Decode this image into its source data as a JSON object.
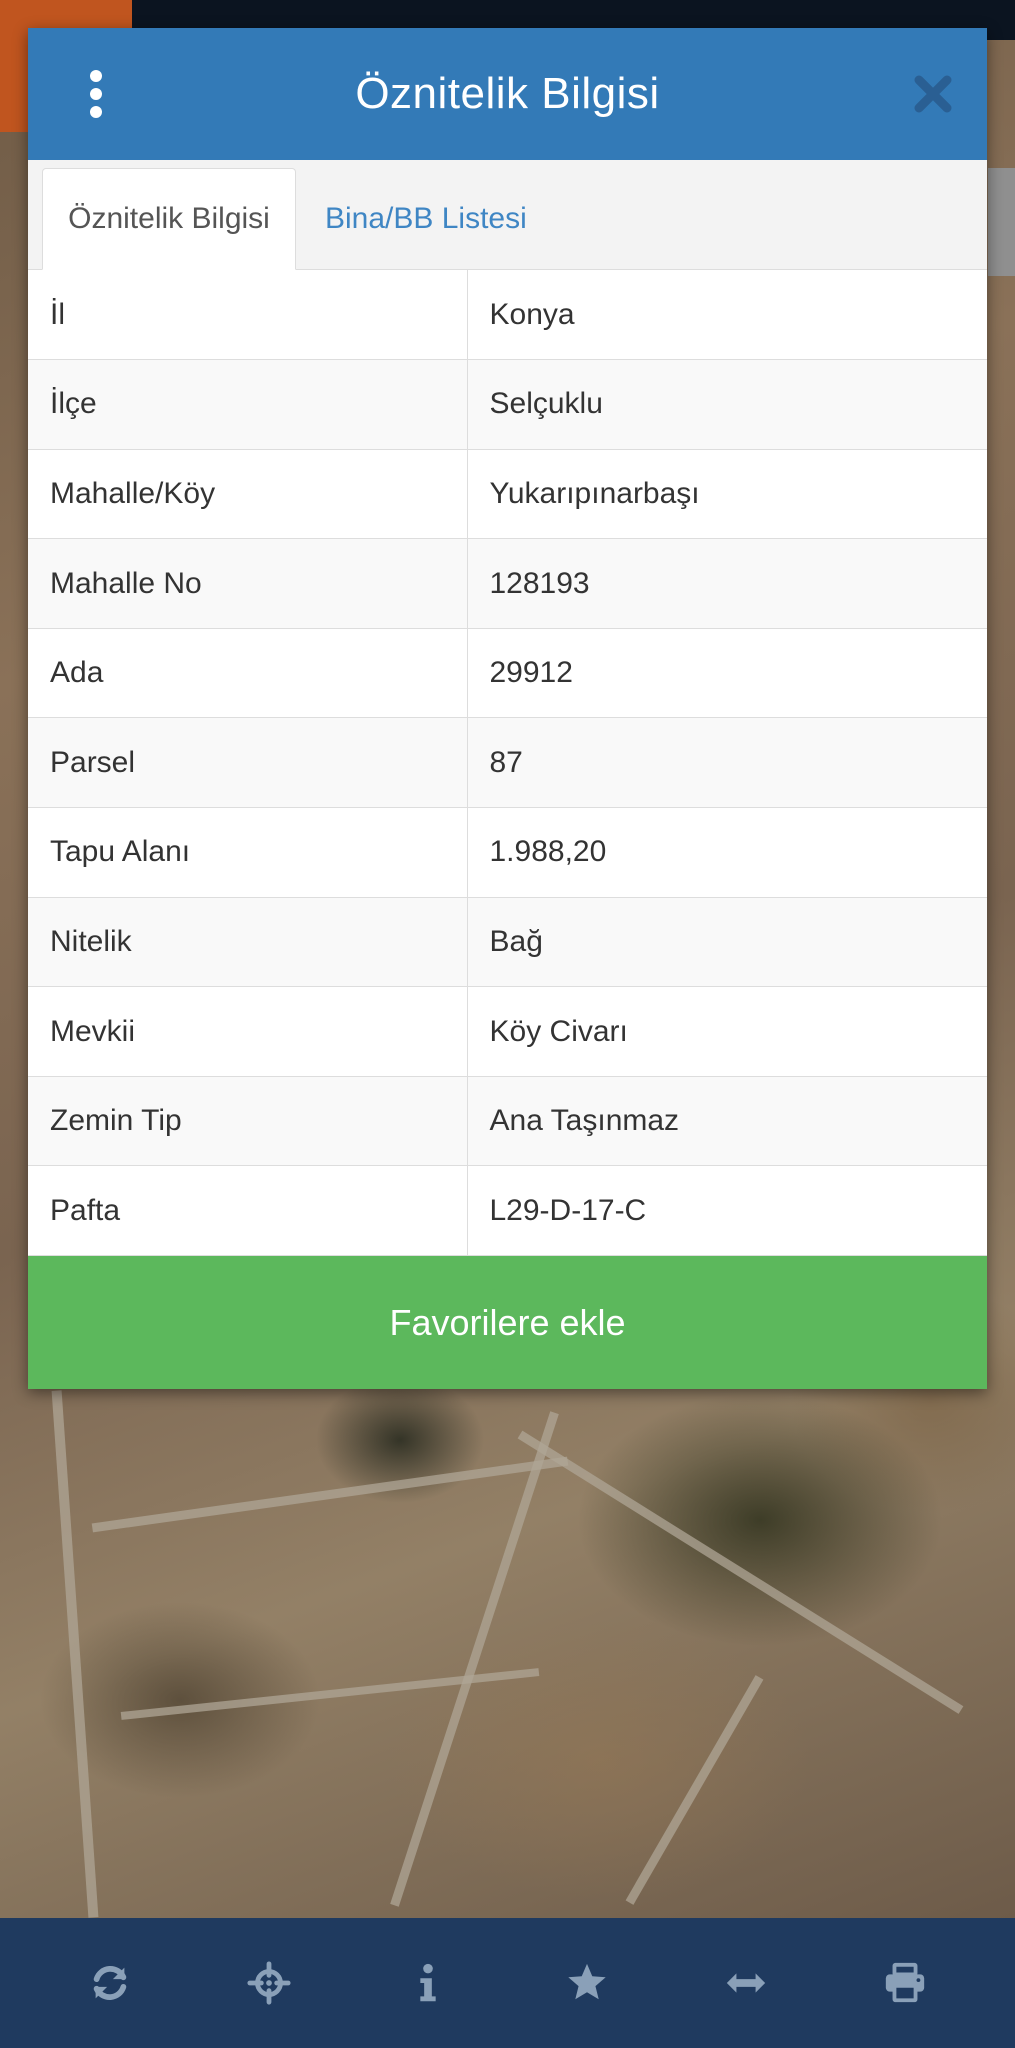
{
  "modal": {
    "title": "Öznitelik Bilgisi"
  },
  "tabs": [
    {
      "label": "Öznitelik Bilgisi",
      "active": true
    },
    {
      "label": "Bina/BB Listesi",
      "active": false
    }
  ],
  "attributes": [
    {
      "key": "İl",
      "value": "Konya"
    },
    {
      "key": "İlçe",
      "value": "Selçuklu"
    },
    {
      "key": "Mahalle/Köy",
      "value": "Yukarıpınarbaşı"
    },
    {
      "key": "Mahalle No",
      "value": "128193"
    },
    {
      "key": "Ada",
      "value": "29912"
    },
    {
      "key": "Parsel",
      "value": "87"
    },
    {
      "key": "Tapu Alanı",
      "value": "1.988,20"
    },
    {
      "key": "Nitelik",
      "value": "Bağ"
    },
    {
      "key": "Mevkii",
      "value": "Köy Civarı"
    },
    {
      "key": "Zemin Tip",
      "value": "Ana Taşınmaz"
    },
    {
      "key": "Pafta",
      "value": "L29-D-17-C"
    }
  ],
  "favorite_button": {
    "label": "Favorilere ekle"
  },
  "toolbar": {
    "icons": [
      "refresh-icon",
      "crosshair-icon",
      "info-icon",
      "star-icon",
      "horizontal-arrows-icon",
      "print-icon"
    ]
  },
  "colors": {
    "header": "#337ab7",
    "tab_link": "#3f86c4",
    "favorite": "#5cb85c",
    "toolbar": "#1f3a5f",
    "toolbar_icon": "#8aa0b8"
  }
}
